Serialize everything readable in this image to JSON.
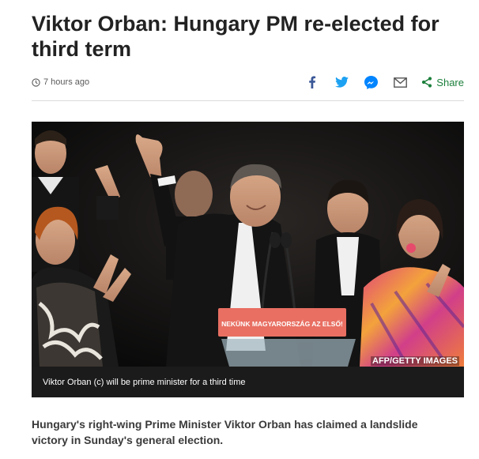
{
  "article": {
    "headline": "Viktor Orban: Hungary PM re-elected for third term",
    "timestamp": "7 hours ago",
    "intro": "Hungary's right-wing Prime Minister Viktor Orban has claimed a landslide victory in Sunday's general election."
  },
  "share": {
    "icons": [
      "facebook-icon",
      "twitter-icon",
      "messenger-icon",
      "email-icon",
      "share-icon"
    ],
    "label": "Share",
    "colors": {
      "facebook": "#3b5998",
      "twitter": "#1da1f2",
      "messenger": "#0084ff",
      "email": "#555555",
      "share": "#1b7f3b"
    }
  },
  "media": {
    "credit": "AFP/GETTY IMAGES",
    "podium_sign": "NEKÜNK MAGYARORSZÁG AZ ELSŐ!",
    "caption": "Viktor Orban (c) will be prime minister for a third time"
  }
}
